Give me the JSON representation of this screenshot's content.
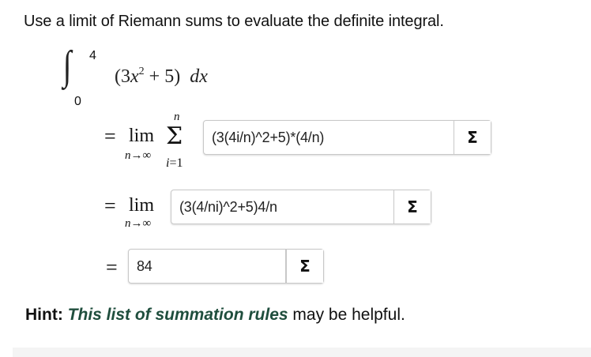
{
  "prompt": "Use a limit of Riemann sums to evaluate the definite integral.",
  "integral": {
    "upper_limit": "4",
    "lower_limit": "0",
    "integrand_open": "(3",
    "integrand_x": "x",
    "integrand_exp": "2",
    "integrand_rest": " + 5)",
    "differential": "dx"
  },
  "step1": {
    "equals": "=",
    "lim": "lim",
    "lim_sub": "n→∞",
    "sigma_symbol": "Σ",
    "sigma_top": "n",
    "sigma_bottom_var": "i",
    "sigma_bottom_rest": "=1",
    "answer_value": "(3(4i/n)^2+5)*(4/n)",
    "button_label": "Σ"
  },
  "step2": {
    "equals": "=",
    "lim": "lim",
    "lim_sub": "n→∞",
    "answer_value": "(3(4/ni)^2+5)4/n",
    "button_label": "Σ"
  },
  "step3": {
    "equals": "=",
    "answer_value": "84",
    "button_label": "Σ"
  },
  "hint": {
    "label": "Hint:",
    "link_text": "This list of summation rules",
    "rest": " may be helpful."
  },
  "colors": {
    "hint_link": "#1f4e3d",
    "box_border": "#c8c8c8"
  }
}
